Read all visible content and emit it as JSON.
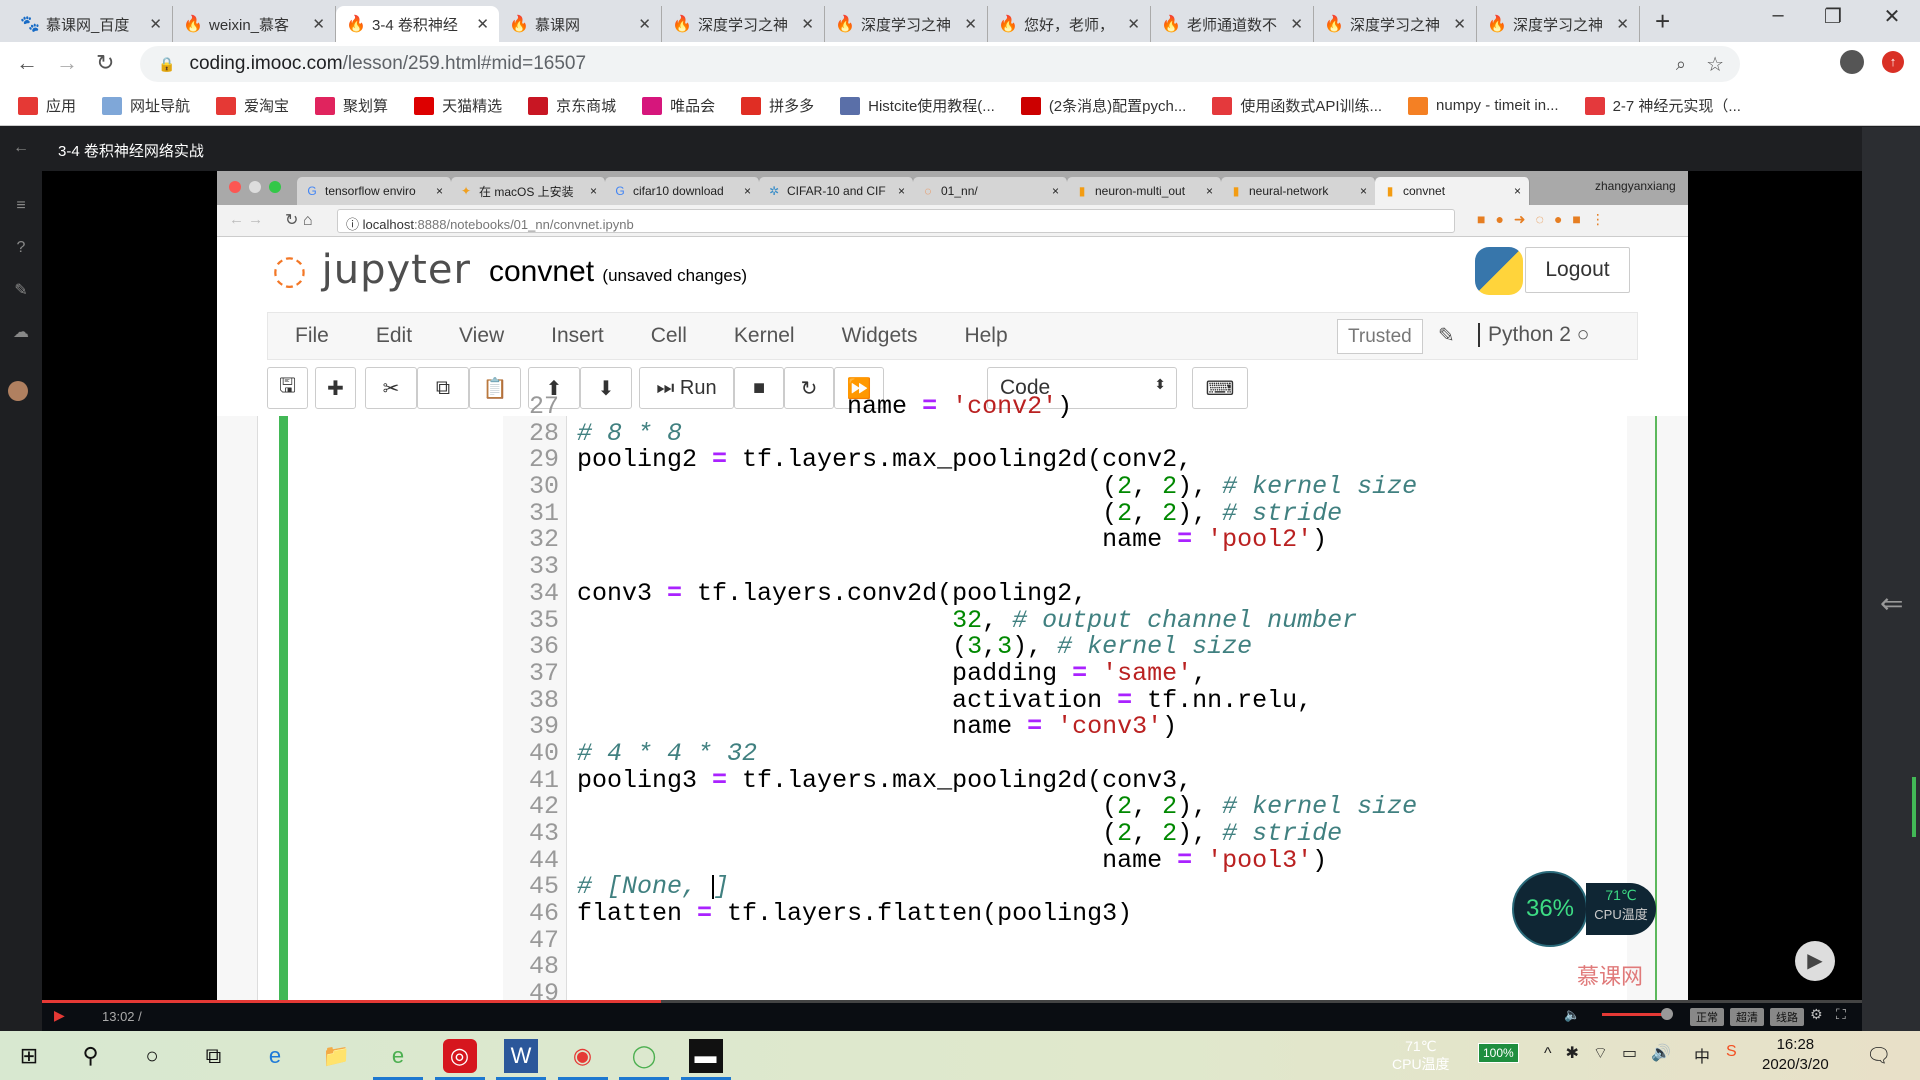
{
  "browser": {
    "tabs": [
      {
        "title": "慕课网_百度",
        "icon": "paw-icon"
      },
      {
        "title": "weixin_慕客",
        "icon": "flame-icon"
      },
      {
        "title": "3-4 卷积神经",
        "icon": "flame-icon",
        "active": true
      },
      {
        "title": "慕课网",
        "icon": "flame-icon"
      },
      {
        "title": "深度学习之神",
        "icon": "flame-icon"
      },
      {
        "title": "深度学习之神",
        "icon": "flame-icon"
      },
      {
        "title": "您好，老师，",
        "icon": "flame-icon"
      },
      {
        "title": "老师通道数不",
        "icon": "flame-icon"
      },
      {
        "title": "深度学习之神",
        "icon": "flame-icon"
      },
      {
        "title": "深度学习之神",
        "icon": "flame-icon"
      }
    ],
    "url_host": "coding.imooc.com",
    "url_path": "/lesson/259.html#mid=16507",
    "bookmarks": [
      {
        "label": "应用",
        "color": "#e53935"
      },
      {
        "label": "网址导航",
        "color": "#7fa7d8"
      },
      {
        "label": "爱淘宝",
        "color": "#e53935"
      },
      {
        "label": "聚划算",
        "color": "#e0245e"
      },
      {
        "label": "天猫精选",
        "color": "#d00"
      },
      {
        "label": "京东商城",
        "color": "#c81623"
      },
      {
        "label": "唯品会",
        "color": "#d6167c"
      },
      {
        "label": "拼多多",
        "color": "#e02e24"
      },
      {
        "label": "Histcite使用教程(...",
        "color": "#5a6fa8"
      },
      {
        "label": "(2条消息)配置pych...",
        "color": "#c00"
      },
      {
        "label": "使用函数式API训练...",
        "color": "#e4393c"
      },
      {
        "label": "numpy - timeit in...",
        "color": "#f48024"
      },
      {
        "label": "2-7 神经元实现（...",
        "color": "#e4393c"
      }
    ]
  },
  "player": {
    "title": "3-4 卷积神经网络实战",
    "time": "13:02 /",
    "progress": 0.34,
    "quality": [
      "正常",
      "超清",
      "线路"
    ],
    "volume": 1.0,
    "watermark": "慕课网"
  },
  "inner": {
    "tabs": [
      {
        "title": "tensorflow enviro",
        "icon": "G",
        "color": "#4285f4"
      },
      {
        "title": "在 macOS 上安装",
        "icon": "✦",
        "color": "#f0a020"
      },
      {
        "title": "cifar10 download",
        "icon": "G",
        "color": "#4285f4"
      },
      {
        "title": "CIFAR-10 and CIF",
        "icon": "✲",
        "color": "#3a8ec8"
      },
      {
        "title": "01_nn/",
        "icon": "◌",
        "color": "#f37726"
      },
      {
        "title": "neuron-multi_out",
        "icon": "▮",
        "color": "#f39c12"
      },
      {
        "title": "neural-network",
        "icon": "▮",
        "color": "#f39c12"
      },
      {
        "title": "convnet",
        "icon": "▮",
        "color": "#f39c12",
        "active": true
      }
    ],
    "user": "zhangyanxiang",
    "url_host": "localhost",
    "url_rest": ":8888/notebooks/01_nn/convnet.ipynb"
  },
  "jupyter": {
    "logo": "jupyter",
    "notebook": "convnet",
    "status": "(unsaved changes)",
    "logout": "Logout",
    "menu": [
      "File",
      "Edit",
      "View",
      "Insert",
      "Cell",
      "Kernel",
      "Widgets",
      "Help"
    ],
    "trusted": "Trusted",
    "kernel": "Python 2",
    "run_label": "Run",
    "cell_type": "Code"
  },
  "code": [
    {
      "n": "27",
      "segs": [
        [
          "p",
          "                  name "
        ],
        [
          "k",
          "="
        ],
        [
          "p",
          " "
        ],
        [
          "s",
          "'conv2'"
        ],
        [
          "p",
          ")"
        ]
      ]
    },
    {
      "n": "28",
      "segs": [
        [
          "c",
          "# 8 * 8"
        ]
      ]
    },
    {
      "n": "29",
      "segs": [
        [
          "p",
          "pooling2 "
        ],
        [
          "k",
          "="
        ],
        [
          "p",
          " tf.layers.max_pooling2d(conv2,"
        ]
      ]
    },
    {
      "n": "30",
      "segs": [
        [
          "p",
          "                                   ("
        ],
        [
          "n",
          "2"
        ],
        [
          "p",
          ", "
        ],
        [
          "n",
          "2"
        ],
        [
          "p",
          "), "
        ],
        [
          "c",
          "# kernel size"
        ]
      ]
    },
    {
      "n": "31",
      "segs": [
        [
          "p",
          "                                   ("
        ],
        [
          "n",
          "2"
        ],
        [
          "p",
          ", "
        ],
        [
          "n",
          "2"
        ],
        [
          "p",
          "), "
        ],
        [
          "c",
          "# stride"
        ]
      ]
    },
    {
      "n": "32",
      "segs": [
        [
          "p",
          "                                   name "
        ],
        [
          "k",
          "="
        ],
        [
          "p",
          " "
        ],
        [
          "s",
          "'pool2'"
        ],
        [
          "p",
          ")"
        ]
      ]
    },
    {
      "n": "33",
      "segs": []
    },
    {
      "n": "34",
      "segs": [
        [
          "p",
          "conv3 "
        ],
        [
          "k",
          "="
        ],
        [
          "p",
          " tf.layers.conv2d(pooling2,"
        ]
      ]
    },
    {
      "n": "35",
      "segs": [
        [
          "p",
          "                         "
        ],
        [
          "n",
          "32"
        ],
        [
          "p",
          ", "
        ],
        [
          "c",
          "# output channel number"
        ]
      ]
    },
    {
      "n": "36",
      "segs": [
        [
          "p",
          "                         ("
        ],
        [
          "n",
          "3"
        ],
        [
          "p",
          ","
        ],
        [
          "n",
          "3"
        ],
        [
          "p",
          "), "
        ],
        [
          "c",
          "# kernel size"
        ]
      ]
    },
    {
      "n": "37",
      "segs": [
        [
          "p",
          "                         padding "
        ],
        [
          "k",
          "="
        ],
        [
          "p",
          " "
        ],
        [
          "s",
          "'same'"
        ],
        [
          "p",
          ","
        ]
      ]
    },
    {
      "n": "38",
      "segs": [
        [
          "p",
          "                         activation "
        ],
        [
          "k",
          "="
        ],
        [
          "p",
          " tf.nn.relu,"
        ]
      ]
    },
    {
      "n": "39",
      "segs": [
        [
          "p",
          "                         name "
        ],
        [
          "k",
          "="
        ],
        [
          "p",
          " "
        ],
        [
          "s",
          "'conv3'"
        ],
        [
          "p",
          ")"
        ]
      ]
    },
    {
      "n": "40",
      "segs": [
        [
          "c",
          "# 4 * 4 * 32"
        ]
      ]
    },
    {
      "n": "41",
      "segs": [
        [
          "p",
          "pooling3 "
        ],
        [
          "k",
          "="
        ],
        [
          "p",
          " tf.layers.max_pooling2d(conv3,"
        ]
      ]
    },
    {
      "n": "42",
      "segs": [
        [
          "p",
          "                                   ("
        ],
        [
          "n",
          "2"
        ],
        [
          "p",
          ", "
        ],
        [
          "n",
          "2"
        ],
        [
          "p",
          "), "
        ],
        [
          "c",
          "# kernel size"
        ]
      ]
    },
    {
      "n": "43",
      "segs": [
        [
          "p",
          "                                   ("
        ],
        [
          "n",
          "2"
        ],
        [
          "p",
          ", "
        ],
        [
          "n",
          "2"
        ],
        [
          "p",
          "), "
        ],
        [
          "c",
          "# stride"
        ]
      ]
    },
    {
      "n": "44",
      "segs": [
        [
          "p",
          "                                   name "
        ],
        [
          "k",
          "="
        ],
        [
          "p",
          " "
        ],
        [
          "s",
          "'pool3'"
        ],
        [
          "p",
          ")"
        ]
      ]
    },
    {
      "n": "45",
      "segs": [
        [
          "c",
          "# [None, "
        ],
        [
          "cursor",
          ""
        ],
        [
          "c",
          "]"
        ]
      ]
    },
    {
      "n": "46",
      "segs": [
        [
          "p",
          "flatten "
        ],
        [
          "k",
          "="
        ],
        [
          "p",
          " tf.layers.flatten(pooling3)"
        ]
      ]
    },
    {
      "n": "47",
      "segs": []
    },
    {
      "n": "48",
      "segs": []
    },
    {
      "n": "49",
      "segs": []
    }
  ],
  "cpu_widget": {
    "usage": "36%",
    "temp": "71℃",
    "label": "CPU温度"
  },
  "taskbar": {
    "apps": [
      "windows-start-icon",
      "search-icon",
      "cortana-icon",
      "task-view-icon",
      "edge-icon",
      "file-explorer-icon",
      "ie360-icon",
      "netease-music-icon",
      "word-icon",
      "chrome-icon",
      "green-app-icon",
      "terminal-icon"
    ],
    "cpu_temp": "71℃",
    "cpu_label": "CPU温度",
    "battery": "100%",
    "ime": "中",
    "time": "16:28",
    "date": "2020/3/20"
  }
}
